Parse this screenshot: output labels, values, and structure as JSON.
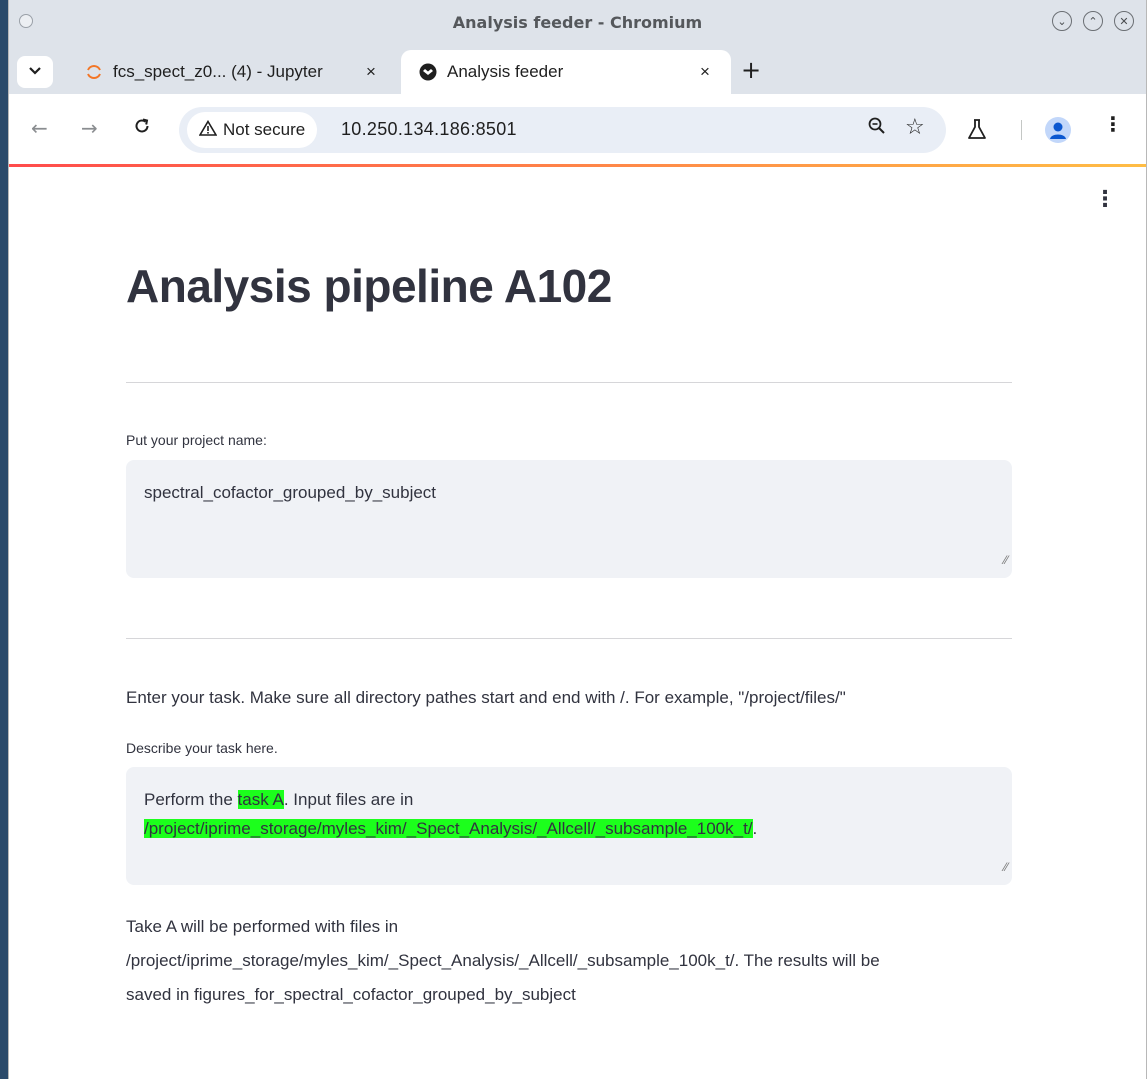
{
  "window": {
    "title": "Analysis feeder - Chromium"
  },
  "tabs": [
    {
      "label": "fcs_spect_z0... (4) - Jupyter",
      "close": "×"
    },
    {
      "label": "Analysis feeder",
      "close": "×"
    }
  ],
  "new_tab": "+",
  "toolbar": {
    "security_label": "Not secure",
    "url": "10.250.134.186:8501"
  },
  "page": {
    "title": "Analysis pipeline A102",
    "project_label": "Put your project name:",
    "project_value": "spectral_cofactor_grouped_by_subject",
    "instructions": "Enter your task. Make sure all directory pathes start and end with /. For example, \"/project/files/\"",
    "task_label": "Describe your task here.",
    "task_value": {
      "part1": "Perform the ",
      "highlight1": "task A",
      "part2": ". Input files are in ",
      "highlight2": "/project/iprime_storage/myles_kim/_Spect_Analysis/_Allcell/_subsample_100k_t/",
      "part3": "."
    },
    "result_text": {
      "line1": "Take A will be performed with files in",
      "line2": "/project/iprime_storage/myles_kim/_Spect_Analysis/_Allcell/_subsample_100k_t/. The results will be",
      "line3": "saved in figures_for_spectral_cofactor_grouped_by_subject"
    }
  },
  "colors": {
    "highlight": "#1cff1c",
    "text": "#31333f",
    "input_bg": "#f0f2f6"
  }
}
